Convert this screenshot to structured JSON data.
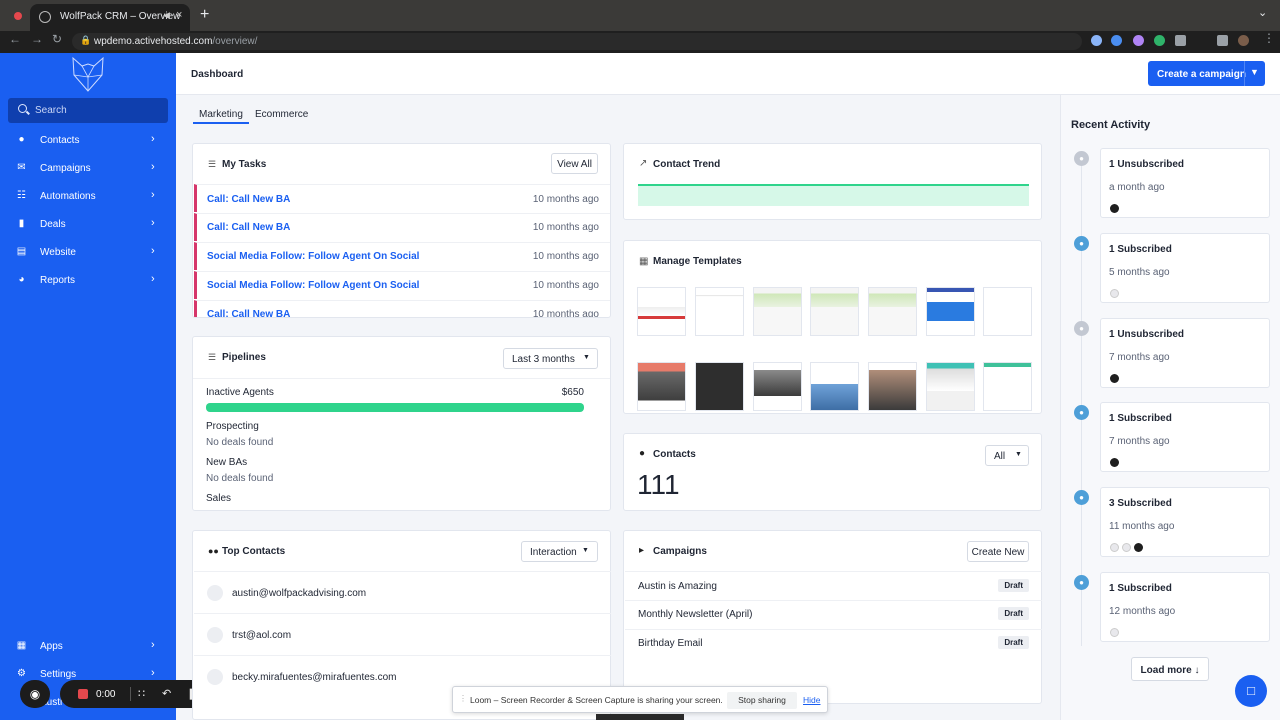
{
  "browser": {
    "tab_title": "WolfPack CRM – Overview",
    "url_host": "wpdemo.activehosted.com",
    "url_path": "/overview/",
    "new_tab": "+",
    "tab_close": "×"
  },
  "sidebar": {
    "search_placeholder": "Search",
    "items": [
      {
        "label": "Contacts",
        "icon": "person-icon"
      },
      {
        "label": "Campaigns",
        "icon": "envelope-icon"
      },
      {
        "label": "Automations",
        "icon": "automation-icon"
      },
      {
        "label": "Deals",
        "icon": "deals-icon"
      },
      {
        "label": "Website",
        "icon": "website-icon"
      },
      {
        "label": "Reports",
        "icon": "pie-chart-icon"
      }
    ],
    "bottom_items": [
      {
        "label": "Apps",
        "icon": "apps-icon"
      },
      {
        "label": "Settings",
        "icon": "gear-icon"
      }
    ],
    "user_label": "Austi"
  },
  "loom": {
    "time": "0:00",
    "banner_text": "Loom – Screen Recorder & Screen Capture is sharing your screen.",
    "stop_label": "Stop sharing",
    "hide_label": "Hide"
  },
  "header": {
    "title": "Dashboard",
    "create_label": "Create a campaign"
  },
  "tabs": {
    "marketing": "Marketing",
    "ecommerce": "Ecommerce"
  },
  "tasks": {
    "title": "My Tasks",
    "view_all": "View All",
    "items": [
      {
        "label": "Call: Call New BA",
        "when": "10 months ago"
      },
      {
        "label": "Call: Call New BA",
        "when": "10 months ago"
      },
      {
        "label": "Social Media Follow: Follow Agent On Social",
        "when": "10 months ago"
      },
      {
        "label": "Social Media Follow: Follow Agent On Social",
        "when": "10 months ago"
      },
      {
        "label": "Call: Call New BA",
        "when": "10 months ago"
      }
    ]
  },
  "contact_trend": {
    "title": "Contact Trend"
  },
  "pipelines": {
    "title": "Pipelines",
    "range": "Last 3 months",
    "stages": [
      {
        "name": "Inactive Agents",
        "value": "$650",
        "fill": 1.0
      },
      {
        "name": "Prospecting",
        "status": "No deals found"
      },
      {
        "name": "New BAs",
        "status": "No deals found"
      },
      {
        "name": "Sales"
      }
    ]
  },
  "templates": {
    "title": "Manage Templates"
  },
  "contacts_card": {
    "title": "Contacts",
    "filter": "All",
    "count": "111"
  },
  "top_contacts": {
    "title": "Top Contacts",
    "sort": "Interaction",
    "items": [
      "austin@wolfpackadvising.com",
      "trst@aol.com",
      "becky.mirafuentes@mirafuentes.com"
    ]
  },
  "campaigns": {
    "title": "Campaigns",
    "create_new": "Create New",
    "items": [
      {
        "name": "Austin is Amazing",
        "status": "Draft"
      },
      {
        "name": "Monthly Newsletter (April)",
        "status": "Draft"
      },
      {
        "name": "Birthday Email",
        "status": "Draft"
      }
    ]
  },
  "activity": {
    "title": "Recent Activity",
    "load_more": "Load more",
    "items": [
      {
        "title": "1 Unsubscribed",
        "when": "a month ago"
      },
      {
        "title": "1 Subscribed",
        "when": "5 months ago"
      },
      {
        "title": "1 Unsubscribed",
        "when": "7 months ago"
      },
      {
        "title": "1 Subscribed",
        "when": "7 months ago"
      },
      {
        "title": "3 Subscribed",
        "when": "11 months ago"
      },
      {
        "title": "1 Subscribed",
        "when": "12 months ago"
      }
    ]
  },
  "colors": {
    "brand": "#1a5ff1",
    "success": "#2fd48c",
    "task_accent": "#d6366b"
  }
}
